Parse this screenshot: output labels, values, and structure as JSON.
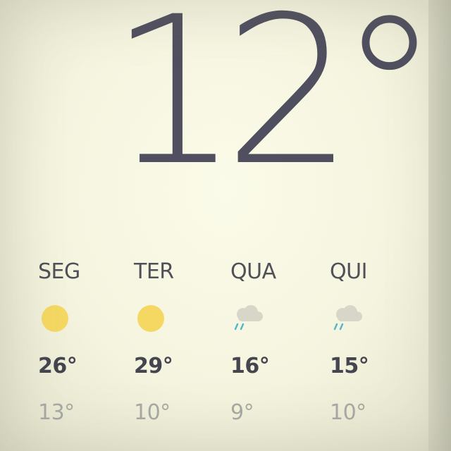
{
  "current": {
    "temperature": "12°"
  },
  "forecast": {
    "days": [
      {
        "day": "SEG",
        "icon": "sun-icon",
        "high": "26°",
        "low": "13°"
      },
      {
        "day": "TER",
        "icon": "sun-icon",
        "high": "29°",
        "low": "10°"
      },
      {
        "day": "QUA",
        "icon": "rain-cloud-icon",
        "high": "16°",
        "low": "9°"
      },
      {
        "day": "QUI",
        "icon": "rain-cloud-icon",
        "high": "15°",
        "low": "10°"
      }
    ]
  },
  "colors": {
    "sun": "#f4d862",
    "cloud": "#d7d6c8",
    "rain": "#4fb8c4",
    "temperature_text": "#4f4f5f"
  }
}
